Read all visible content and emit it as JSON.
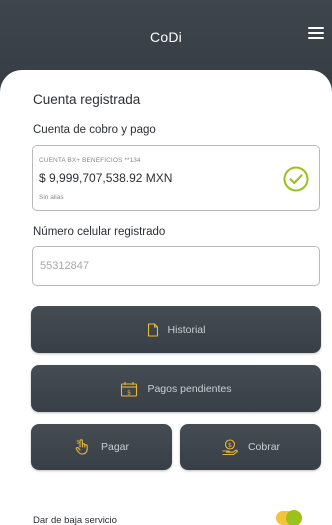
{
  "header": {
    "title": "CoDi"
  },
  "main": {
    "section_title": "Cuenta registrada",
    "account_label": "Cuenta de cobro y pago",
    "account": {
      "name": "CUENTA BX+ BENEFICIOS **134",
      "balance": "$ 9,999,707,538.92 MXN",
      "alias": "Sin alias"
    },
    "phone_label": "Número celular registrado",
    "phone_value": "55312847",
    "buttons": {
      "historial": "Historial",
      "pagos_pendientes": "Pagos pendientes",
      "pagar": "Pagar",
      "cobrar": "Cobrar"
    },
    "dar_de_baja_label": "Dar de baja servicio"
  },
  "colors": {
    "header_bg": "#3b4249",
    "accent_green": "#9ac21a",
    "accent_yellow": "#f2c43a",
    "button_bg": "#40474e"
  },
  "icons": {
    "menu": "menu-icon",
    "check": "check-circle-icon",
    "historial": "document-icon",
    "pagos_pendientes": "calendar-icon",
    "pagar": "hand-pay-icon",
    "cobrar": "money-receive-icon"
  },
  "toggle": {
    "on": true
  }
}
